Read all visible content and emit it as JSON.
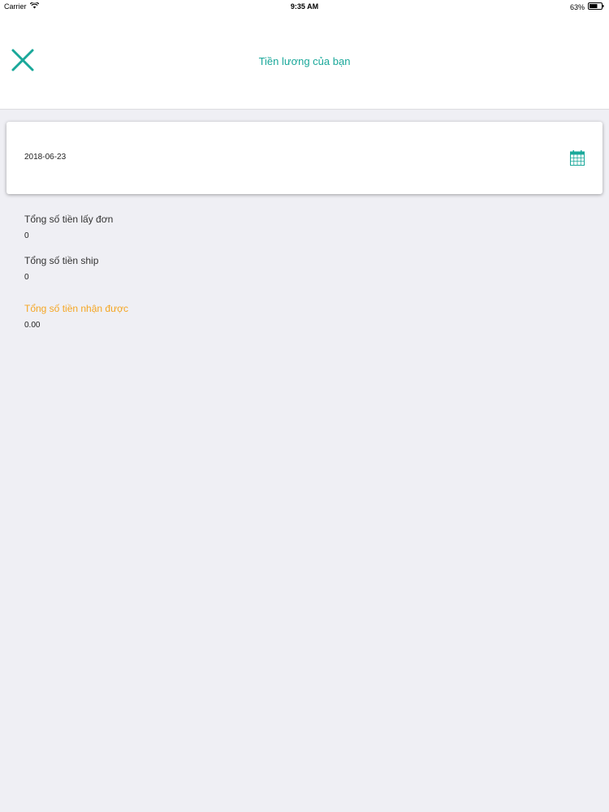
{
  "status_bar": {
    "carrier": "Carrier",
    "time": "9:35 AM",
    "battery_percent": "63%"
  },
  "nav": {
    "title": "Tiền lương của bạn"
  },
  "date_picker": {
    "value": "2018-06-23"
  },
  "summary": {
    "pickup_label": "Tổng số tiền lấy đơn",
    "pickup_value": "0",
    "ship_label": "Tổng số tiền ship",
    "ship_value": "0",
    "received_label": "Tổng số tiền nhận được",
    "received_value": "0.00"
  },
  "colors": {
    "accent": "#1aa89a",
    "highlight": "#f5a623",
    "background": "#efeff4"
  },
  "icons": {
    "close": "close-icon",
    "calendar": "calendar-icon",
    "wifi": "wifi-icon",
    "battery": "battery-icon"
  }
}
